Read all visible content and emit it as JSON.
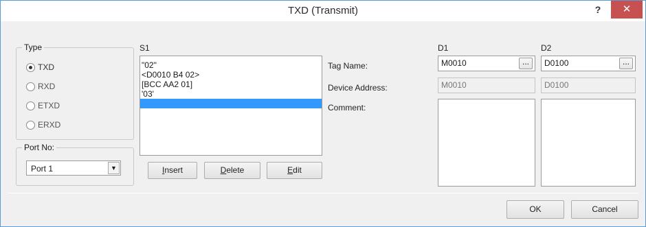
{
  "window": {
    "title": "TXD (Transmit)",
    "help_label": "?",
    "close_label": "✕"
  },
  "type_group": {
    "legend": "Type",
    "options": [
      {
        "label": "TXD",
        "checked": true
      },
      {
        "label": "RXD",
        "checked": false
      },
      {
        "label": "ETXD",
        "checked": false
      },
      {
        "label": "ERXD",
        "checked": false
      }
    ]
  },
  "port_group": {
    "legend": "Port No:",
    "selected": "Port 1"
  },
  "s1": {
    "label": "S1",
    "items": [
      "\"02\"",
      "<D0010 B4 02>",
      "[BCC AA2 01]",
      "'03'",
      ""
    ],
    "selected_index": 4
  },
  "buttons": {
    "insert": {
      "mnemonic": "I",
      "rest": "nsert"
    },
    "delete": {
      "mnemonic": "D",
      "rest": "elete"
    },
    "edit": {
      "mnemonic": "E",
      "rest": "dit"
    },
    "ok": "OK",
    "cancel": "Cancel"
  },
  "labels": {
    "tag_name": "Tag Name:",
    "device_address": "Device Address:",
    "comment": "Comment:"
  },
  "d1": {
    "label": "D1",
    "tag_name": "M0010",
    "device_address": "M0010",
    "browse_label": "...",
    "comment": ""
  },
  "d2": {
    "label": "D2",
    "tag_name": "D0100",
    "device_address": "D0100",
    "browse_label": "...",
    "comment": ""
  }
}
